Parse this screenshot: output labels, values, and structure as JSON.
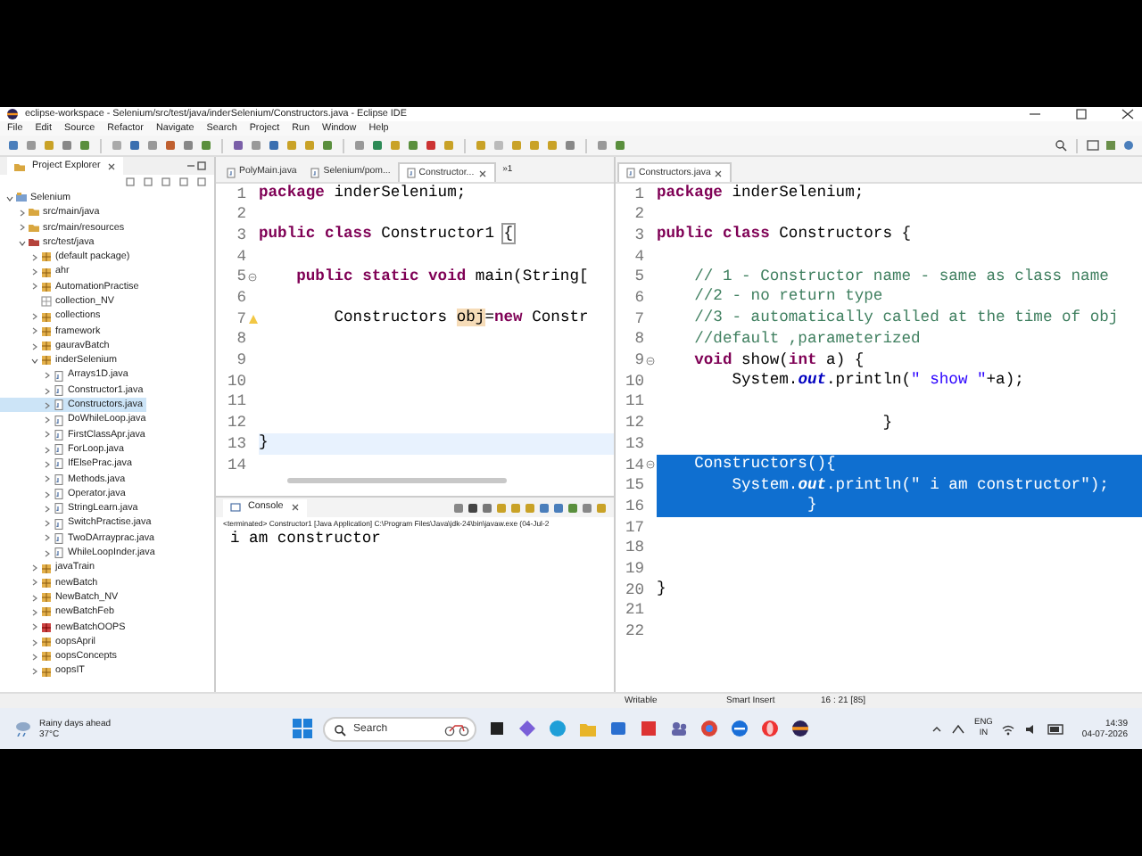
{
  "window": {
    "title": "eclipse-workspace - Selenium/src/test/java/inderSelenium/Constructors.java - Eclipse IDE"
  },
  "menu": [
    "File",
    "Edit",
    "Source",
    "Refactor",
    "Navigate",
    "Search",
    "Project",
    "Run",
    "Window",
    "Help"
  ],
  "project_explorer": {
    "tab": "Project Explorer",
    "tree": [
      {
        "label": "Selenium",
        "kind": "project",
        "expanded": true,
        "selected": false,
        "children": [
          {
            "label": "src/main/java",
            "kind": "folder",
            "expanded": false,
            "selected": false
          },
          {
            "label": "src/main/resources",
            "kind": "folder",
            "expanded": false,
            "selected": false
          },
          {
            "label": "src/test/java",
            "kind": "source",
            "expanded": true,
            "selected": false,
            "children": [
              {
                "label": "(default package)",
                "kind": "package",
                "expanded": false,
                "selected": false
              },
              {
                "label": "ahr",
                "kind": "package",
                "expanded": false,
                "selected": false
              },
              {
                "label": "AutomationPractise",
                "kind": "package",
                "expanded": false,
                "selected": false
              },
              {
                "label": "collection_NV",
                "kind": "empty-package",
                "selected": false
              },
              {
                "label": "collections",
                "kind": "package",
                "expanded": false,
                "selected": false
              },
              {
                "label": "framework",
                "kind": "package",
                "expanded": false,
                "selected": false
              },
              {
                "label": "gauravBatch",
                "kind": "package",
                "expanded": false,
                "selected": false
              },
              {
                "label": "inderSelenium",
                "kind": "package",
                "expanded": true,
                "selected": false,
                "children": [
                  {
                    "label": "Arrays1D.java",
                    "kind": "file",
                    "expanded": false,
                    "selected": false
                  },
                  {
                    "label": "Constructor1.java",
                    "kind": "file",
                    "expanded": false,
                    "selected": false
                  },
                  {
                    "label": "Constructors.java",
                    "kind": "file",
                    "expanded": false,
                    "selected": true
                  },
                  {
                    "label": "DoWhileLoop.java",
                    "kind": "file",
                    "expanded": false,
                    "selected": false
                  },
                  {
                    "label": "FirstClassApr.java",
                    "kind": "file",
                    "expanded": false,
                    "selected": false
                  },
                  {
                    "label": "ForLoop.java",
                    "kind": "file",
                    "expanded": false,
                    "selected": false
                  },
                  {
                    "label": "IfElsePrac.java",
                    "kind": "file",
                    "expanded": false,
                    "selected": false
                  },
                  {
                    "label": "Methods.java",
                    "kind": "file",
                    "expanded": false,
                    "selected": false
                  },
                  {
                    "label": "Operator.java",
                    "kind": "file",
                    "expanded": false,
                    "selected": false
                  },
                  {
                    "label": "StringLearn.java",
                    "kind": "file",
                    "expanded": false,
                    "selected": false
                  },
                  {
                    "label": "SwitchPractise.java",
                    "kind": "file",
                    "expanded": false,
                    "selected": false
                  },
                  {
                    "label": "TwoDArrayprac.java",
                    "kind": "file",
                    "expanded": false,
                    "selected": false
                  },
                  {
                    "label": "WhileLoopInder.java",
                    "kind": "file",
                    "expanded": false,
                    "selected": false
                  }
                ]
              },
              {
                "label": "javaTrain",
                "kind": "package",
                "expanded": false,
                "selected": false
              },
              {
                "label": "newBatch",
                "kind": "package",
                "expanded": false,
                "selected": false
              },
              {
                "label": "NewBatch_NV",
                "kind": "package",
                "expanded": false,
                "selected": false
              },
              {
                "label": "newBatchFeb",
                "kind": "package",
                "expanded": false,
                "selected": false
              },
              {
                "label": "newBatchOOPS",
                "kind": "package-error",
                "expanded": false,
                "selected": false
              },
              {
                "label": "oopsApril",
                "kind": "package",
                "expanded": false,
                "selected": false
              },
              {
                "label": "oopsConcepts",
                "kind": "package",
                "expanded": false,
                "selected": false
              },
              {
                "label": "oopsIT",
                "kind": "package",
                "expanded": false,
                "selected": false
              }
            ]
          }
        ]
      }
    ]
  },
  "editor_left": {
    "tabs": [
      {
        "label": "PolyMain.java",
        "selected": false
      },
      {
        "label": "Selenium/pom...",
        "selected": false
      },
      {
        "label": "Constructor...",
        "selected": true
      }
    ],
    "overflow": "»1",
    "lines": [
      {
        "n": "1",
        "current": false,
        "tokens": [
          {
            "t": "package",
            "kind": "keyword"
          },
          " inderSelenium;"
        ]
      },
      {
        "n": "2",
        "current": false
      },
      {
        "n": "3",
        "current": false,
        "tokens": [
          {
            "t": "public class",
            "kind": "keyword"
          },
          " Constructor1 ",
          {
            "t": "{",
            "kind": "bracket"
          }
        ]
      },
      {
        "n": "4",
        "current": false
      },
      {
        "n": "5",
        "current": false,
        "kind": "fold",
        "tokens": [
          {
            "t": "    public static void",
            "kind": "keyword"
          },
          " main(String["
        ]
      },
      {
        "n": "6",
        "current": false
      },
      {
        "n": "7",
        "current": false,
        "kind": "warning",
        "tokens": [
          "        Constructors ",
          {
            "t": "obj",
            "kind": "occurrence"
          },
          "=",
          {
            "t": "new",
            "kind": "keyword"
          },
          " Constr"
        ]
      },
      {
        "n": "8",
        "current": false
      },
      {
        "n": "9",
        "current": false
      },
      {
        "n": "10",
        "current": false
      },
      {
        "n": "11",
        "current": false
      },
      {
        "n": "12",
        "current": false
      },
      {
        "n": "13",
        "current": true,
        "tokens": [
          "}"
        ]
      },
      {
        "n": "14",
        "current": false
      }
    ]
  },
  "console": {
    "tab": "Console",
    "header": "<terminated> Constructor1 [Java Application] C:\\Program Files\\Java\\jdk-24\\bin\\javaw.exe (04-Jul-2",
    "output": "i am constructor"
  },
  "editor_right": {
    "tabs": [
      {
        "label": "Constructors.java",
        "selected": true
      }
    ],
    "lines": [
      {
        "n": "1",
        "selected": false,
        "tokens": [
          {
            "t": "package",
            "kind": "keyword"
          },
          " inderSelenium;"
        ]
      },
      {
        "n": "2",
        "selected": false
      },
      {
        "n": "3",
        "selected": false,
        "tokens": [
          {
            "t": "public class",
            "kind": "keyword"
          },
          " Constructors {"
        ]
      },
      {
        "n": "4",
        "selected": false
      },
      {
        "n": "5",
        "selected": false,
        "tokens": [
          {
            "t": "    // 1 - Constructor name - same as class name",
            "kind": "comment"
          }
        ]
      },
      {
        "n": "6",
        "selected": false,
        "tokens": [
          {
            "t": "    //2 - no return type",
            "kind": "comment"
          }
        ]
      },
      {
        "n": "7",
        "selected": false,
        "tokens": [
          {
            "t": "    //3 - automatically called at the time of obj",
            "kind": "comment"
          }
        ]
      },
      {
        "n": "8",
        "selected": false,
        "tokens": [
          {
            "t": "    //default ,parameterized",
            "kind": "comment"
          }
        ]
      },
      {
        "n": "9",
        "selected": false,
        "kind": "fold",
        "tokens": [
          {
            "t": "    void",
            "kind": "keyword"
          },
          " show(",
          {
            "t": "int",
            "kind": "keyword"
          },
          " a) {"
        ]
      },
      {
        "n": "10",
        "selected": false,
        "tokens": [
          "        System.",
          {
            "t": "out",
            "kind": "field"
          },
          ".println(",
          {
            "t": "\" show \"",
            "kind": "string"
          },
          "+a);"
        ]
      },
      {
        "n": "11",
        "selected": false
      },
      {
        "n": "12",
        "selected": false,
        "tokens": [
          "                        }"
        ]
      },
      {
        "n": "13",
        "selected": false
      },
      {
        "n": "14",
        "selected": true,
        "kind": "fold",
        "tokens": [
          "    Constructors(){"
        ]
      },
      {
        "n": "15",
        "selected": true,
        "tokens": [
          "        System.",
          {
            "t": "out",
            "kind": "field"
          },
          ".println(",
          {
            "t": "\" i am constructor\"",
            "kind": "string"
          },
          ");"
        ]
      },
      {
        "n": "16",
        "selected": true,
        "tokens": [
          "                }"
        ]
      },
      {
        "n": "17",
        "selected": false
      },
      {
        "n": "18",
        "selected": false
      },
      {
        "n": "19",
        "selected": false
      },
      {
        "n": "20",
        "selected": false,
        "tokens": [
          "}"
        ]
      },
      {
        "n": "21",
        "selected": false
      },
      {
        "n": "22",
        "selected": false
      }
    ]
  },
  "status_bar": [
    "Writable",
    "Smart Insert",
    "16 : 21 [85]"
  ],
  "taskbar": {
    "weather": "Rainy days ahead",
    "temperature": "37°C",
    "search": {
      "placeholder": "Search"
    },
    "language": "ENG",
    "region": "IN",
    "time": "14:39",
    "date": "04-07-2026"
  }
}
